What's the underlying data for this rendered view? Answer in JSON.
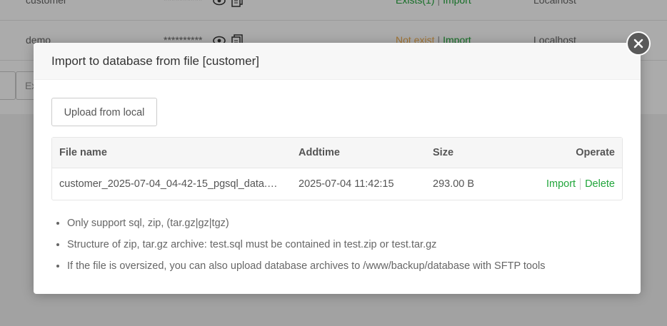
{
  "background": {
    "rows": [
      {
        "name": "customer",
        "password": "**********",
        "status_prefix": "Exists(1)",
        "status_action": "Import",
        "location": "Localhost",
        "status_color": "#20a53a"
      },
      {
        "name": "demo",
        "password": "**********",
        "status_prefix": "Not exist",
        "status_action": "Import",
        "location": "Localhost",
        "status_color": "#f0ad4e"
      }
    ],
    "toolbar": {
      "search_placeholder": "Ex"
    }
  },
  "modal": {
    "title": "Import to database from file [customer]",
    "upload_label": "Upload from local",
    "table": {
      "headers": {
        "name": "File name",
        "addtime": "Addtime",
        "size": "Size",
        "operate": "Operate"
      },
      "rows": [
        {
          "name": "customer_2025-07-04_04-42-15_pgsql_data.s...",
          "addtime": "2025-07-04 11:42:15",
          "size": "293.00 B",
          "import": "Import",
          "delete": "Delete"
        }
      ]
    },
    "notes": [
      "Only support sql, zip, (tar.gz|gz|tgz)",
      "Structure of zip, tar.gz archive: test.sql must be contained in test.zip or test.tar.gz",
      "If the file is oversized, you can also upload database archives to /www/backup/database with SFTP tools"
    ],
    "close_icon": "close-icon"
  },
  "colors": {
    "accent": "#20a53a",
    "warning": "#f0ad4e"
  }
}
